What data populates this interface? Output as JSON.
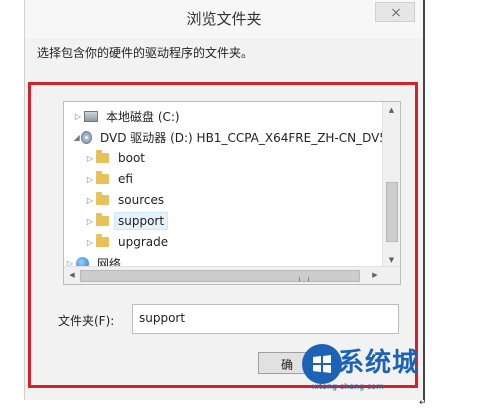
{
  "window": {
    "title": "浏览文件夹",
    "prompt": "选择包含你的硬件的驱动程序的文件夹。"
  },
  "tree": {
    "items": [
      {
        "label": "本地磁盘 (C:)",
        "icon": "drive-icon",
        "expanded": false
      },
      {
        "label": "DVD 驱动器 (D:) HB1_CCPA_X64FRE_ZH-CN_DV5",
        "icon": "dvd-icon",
        "expanded": true
      },
      {
        "label": "boot",
        "icon": "folder-icon",
        "expanded": false
      },
      {
        "label": "efi",
        "icon": "folder-icon",
        "expanded": false
      },
      {
        "label": "sources",
        "icon": "folder-icon",
        "expanded": false
      },
      {
        "label": "support",
        "icon": "folder-icon",
        "expanded": false,
        "selected": true
      },
      {
        "label": "upgrade",
        "icon": "folder-icon",
        "expanded": false
      },
      {
        "label": "网络",
        "icon": "network-icon",
        "expanded": false
      }
    ]
  },
  "folder_field": {
    "label": "文件夹(F):",
    "value": "support"
  },
  "buttons": {
    "ok_label": "确"
  },
  "watermark": {
    "text": "系统城",
    "sub": "xitong cheng com"
  },
  "colors": {
    "highlight_frame": "#d2232a",
    "selection": "#e5f1fb",
    "watermark": "#1d63b5"
  }
}
